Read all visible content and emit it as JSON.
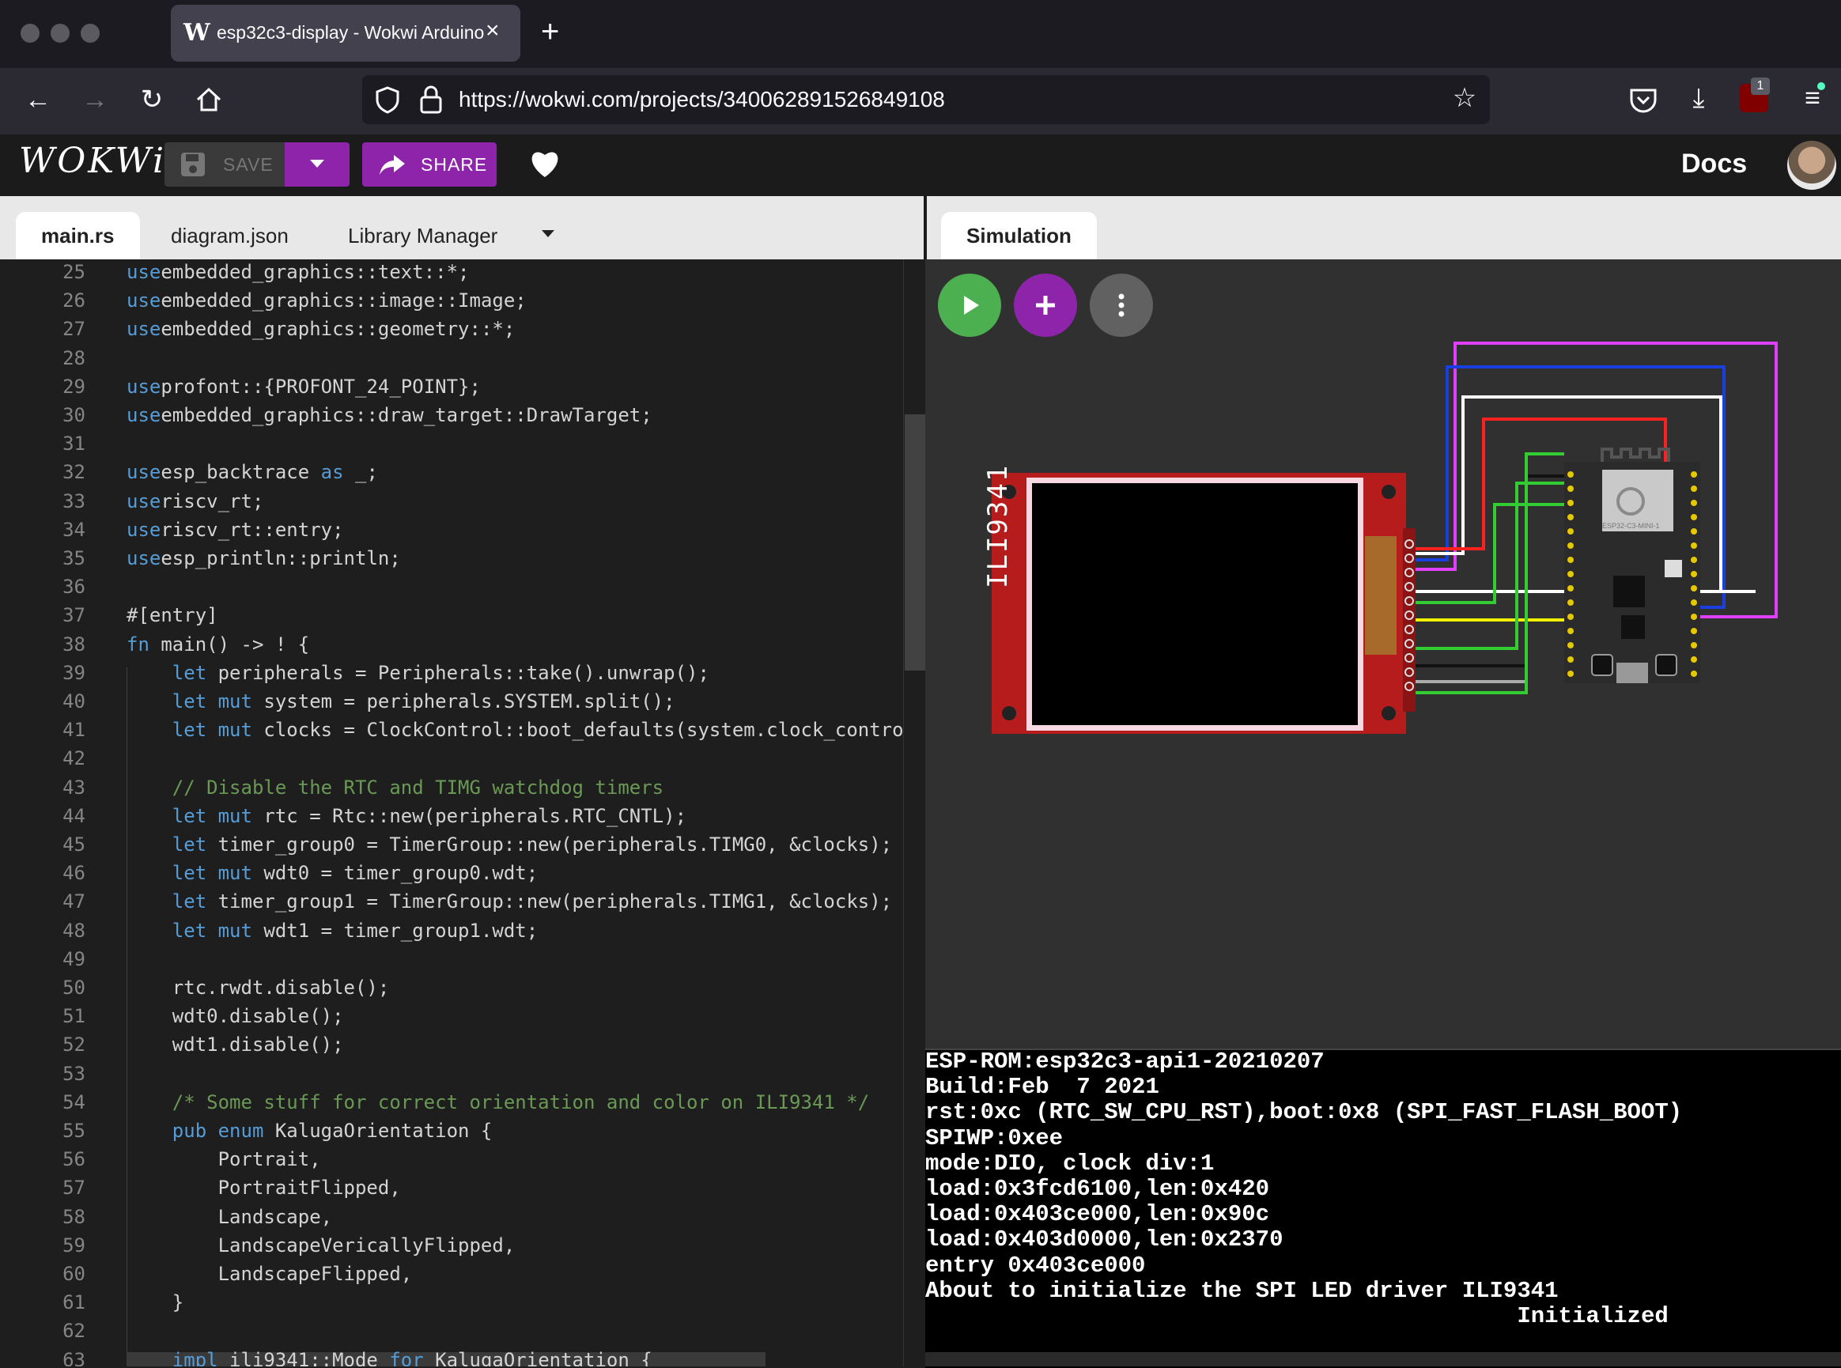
{
  "browser": {
    "tab_title": "esp32c3-display - Wokwi Arduino",
    "tab_close": "×",
    "new_tab": "+",
    "url": "https://wokwi.com/projects/340062891526849108",
    "addon_badge": "1"
  },
  "app": {
    "logo": "WOKWi",
    "save_label": "SAVE",
    "share_label": "SHARE",
    "docs_label": "Docs"
  },
  "editor_tabs": [
    "main.rs",
    "diagram.json",
    "Library Manager"
  ],
  "sim_tab": "Simulation",
  "code_lines": [
    {
      "n": "25",
      "t": [
        [
          "kw",
          "use"
        ],
        [
          "",
          "embedded_graphics::text::*;"
        ]
      ]
    },
    {
      "n": "26",
      "t": [
        [
          "kw",
          "use"
        ],
        [
          "",
          "embedded_graphics::image::Image;"
        ]
      ]
    },
    {
      "n": "27",
      "t": [
        [
          "kw",
          "use"
        ],
        [
          "",
          "embedded_graphics::geometry::*;"
        ]
      ]
    },
    {
      "n": "28",
      "t": []
    },
    {
      "n": "29",
      "t": [
        [
          "kw",
          "use"
        ],
        [
          "",
          "profont::{PROFONT_24_POINT};"
        ]
      ]
    },
    {
      "n": "30",
      "t": [
        [
          "kw",
          "use"
        ],
        [
          "",
          "embedded_graphics::draw_target::DrawTarget;"
        ]
      ]
    },
    {
      "n": "31",
      "t": []
    },
    {
      "n": "32",
      "t": [
        [
          "kw",
          "use"
        ],
        [
          "",
          "esp_backtrace "
        ],
        [
          "kw",
          "as"
        ],
        [
          "",
          " _;"
        ]
      ]
    },
    {
      "n": "33",
      "t": [
        [
          "kw",
          "use"
        ],
        [
          "",
          "riscv_rt;"
        ]
      ]
    },
    {
      "n": "34",
      "t": [
        [
          "kw",
          "use"
        ],
        [
          "",
          "riscv_rt::entry;"
        ]
      ]
    },
    {
      "n": "35",
      "t": [
        [
          "kw",
          "use"
        ],
        [
          "",
          "esp_println::println;"
        ]
      ]
    },
    {
      "n": "36",
      "t": []
    },
    {
      "n": "37",
      "t": [
        [
          "",
          "#[entry]"
        ]
      ]
    },
    {
      "n": "38",
      "t": [
        [
          "kw",
          "fn"
        ],
        [
          "",
          " main() -> ! {"
        ]
      ]
    },
    {
      "n": "39",
      "t": [
        [
          "",
          "    "
        ],
        [
          "kw",
          "let"
        ],
        [
          "",
          " peripherals = Peripherals::take().unwrap();"
        ]
      ]
    },
    {
      "n": "40",
      "t": [
        [
          "",
          "    "
        ],
        [
          "kw",
          "let mut"
        ],
        [
          "",
          " system = peripherals.SYSTEM.split();"
        ]
      ]
    },
    {
      "n": "41",
      "t": [
        [
          "",
          "    "
        ],
        [
          "kw",
          "let mut"
        ],
        [
          "",
          " clocks = ClockControl::boot_defaults(system.clock_control)"
        ]
      ]
    },
    {
      "n": "42",
      "t": []
    },
    {
      "n": "43",
      "t": [
        [
          "",
          "    "
        ],
        [
          "cm",
          "// Disable the RTC and TIMG watchdog timers"
        ]
      ]
    },
    {
      "n": "44",
      "t": [
        [
          "",
          "    "
        ],
        [
          "kw",
          "let mut"
        ],
        [
          "",
          " rtc = Rtc::new(peripherals.RTC_CNTL);"
        ]
      ]
    },
    {
      "n": "45",
      "t": [
        [
          "",
          "    "
        ],
        [
          "kw",
          "let"
        ],
        [
          "",
          " timer_group0 = TimerGroup::new(peripherals.TIMG0, &clocks);"
        ]
      ]
    },
    {
      "n": "46",
      "t": [
        [
          "",
          "    "
        ],
        [
          "kw",
          "let mut"
        ],
        [
          "",
          " wdt0 = timer_group0.wdt;"
        ]
      ]
    },
    {
      "n": "47",
      "t": [
        [
          "",
          "    "
        ],
        [
          "kw",
          "let"
        ],
        [
          "",
          " timer_group1 = TimerGroup::new(peripherals.TIMG1, &clocks);"
        ]
      ]
    },
    {
      "n": "48",
      "t": [
        [
          "",
          "    "
        ],
        [
          "kw",
          "let mut"
        ],
        [
          "",
          " wdt1 = timer_group1.wdt;"
        ]
      ]
    },
    {
      "n": "49",
      "t": []
    },
    {
      "n": "50",
      "t": [
        [
          "",
          "    rtc.rwdt.disable();"
        ]
      ]
    },
    {
      "n": "51",
      "t": [
        [
          "",
          "    wdt0.disable();"
        ]
      ]
    },
    {
      "n": "52",
      "t": [
        [
          "",
          "    wdt1.disable();"
        ]
      ]
    },
    {
      "n": "53",
      "t": []
    },
    {
      "n": "54",
      "t": [
        [
          "",
          "    "
        ],
        [
          "cm",
          "/* Some stuff for correct orientation and color on ILI9341 */"
        ]
      ]
    },
    {
      "n": "55",
      "t": [
        [
          "",
          "    "
        ],
        [
          "kw",
          "pub enum"
        ],
        [
          "",
          " KalugaOrientation {"
        ]
      ]
    },
    {
      "n": "56",
      "t": [
        [
          "",
          "        Portrait,"
        ]
      ]
    },
    {
      "n": "57",
      "t": [
        [
          "",
          "        PortraitFlipped,"
        ]
      ]
    },
    {
      "n": "58",
      "t": [
        [
          "",
          "        Landscape,"
        ]
      ]
    },
    {
      "n": "59",
      "t": [
        [
          "",
          "        LandscapeVericallyFlipped,"
        ]
      ]
    },
    {
      "n": "60",
      "t": [
        [
          "",
          "        LandscapeFlipped,"
        ]
      ]
    },
    {
      "n": "61",
      "t": [
        [
          "",
          "    }"
        ]
      ]
    },
    {
      "n": "62",
      "t": []
    },
    {
      "n": "63",
      "t": [
        [
          "",
          "    "
        ],
        [
          "kw",
          "impl"
        ],
        [
          "",
          " ili9341::Mode "
        ],
        [
          "kw",
          "for"
        ],
        [
          "",
          " KalugaOrientation {"
        ]
      ]
    }
  ],
  "display_label": "ILI9341",
  "board_label": "ESP32-C3-MINI-1",
  "serial_lines": [
    "ESP-ROM:esp32c3-api1-20210207",
    "Build:Feb  7 2021",
    "rst:0xc (RTC_SW_CPU_RST),boot:0x8 (SPI_FAST_FLASH_BOOT)",
    "SPIWP:0xee",
    "mode:DIO, clock div:1",
    "load:0x3fcd6100,len:0x420",
    "load:0x403ce000,len:0x90c",
    "load:0x403d0000,len:0x2370",
    "entry 0x403ce000",
    "About to initialize the SPI LED driver ILI9341",
    "                                           Initialized"
  ],
  "colors": {
    "accent": "#8e24aa",
    "run": "#4caf50",
    "wire_magenta": "#e040fb",
    "wire_blue": "#1a3fe0",
    "wire_red": "#ff2020",
    "wire_green": "#33cc33",
    "wire_yellow": "#f0f000"
  }
}
